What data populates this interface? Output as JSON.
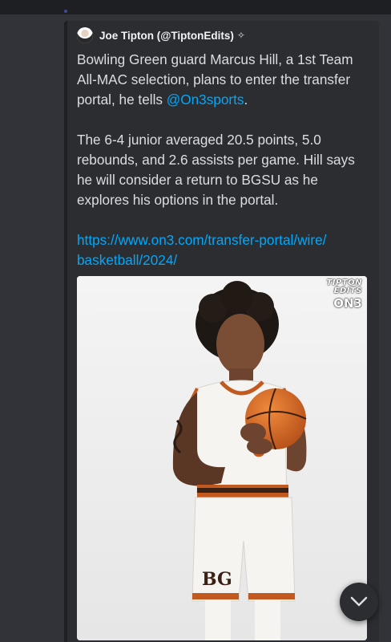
{
  "embed": {
    "author": {
      "name": "Joe Tipton (@TiptonEdits)",
      "verified_icon": "verified-sparkle-icon"
    },
    "description": {
      "p1_text": "Bowling Green guard Marcus Hill, a 1st Team All-MAC selection, plans to enter the transfer portal, he tells ",
      "p1_mention": "@On3sports",
      "p1_end": ".",
      "p2_text": "The 6-4 junior averaged 20.5 points, 5.0 rebounds, and 2.6 assists per game. Hill says he will consider a return to BGSU as he explores his options in the portal.",
      "link_line1": "https://www.on3.com/transfer-portal/wire/",
      "link_line2": "basketball/2024/"
    },
    "image": {
      "watermark_line1": "TIPTON",
      "watermark_line2": "EDITS",
      "watermark_line3": "ON3"
    }
  },
  "scroll_button": {
    "icon": "chevron-down-icon"
  },
  "colors": {
    "background": "#313338",
    "embed_bg": "#2b2d31",
    "link": "#00a8fc",
    "text": "#dbdee1"
  }
}
